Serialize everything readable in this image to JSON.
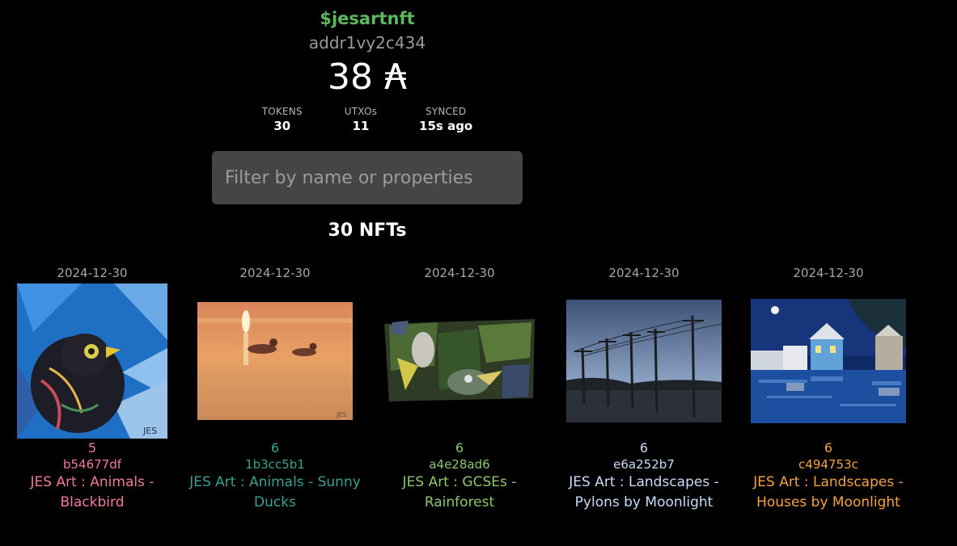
{
  "wallet": {
    "handle": "$jesartnft",
    "address": "addr1vy2c434",
    "balance_value": "38",
    "balance_symbol": "₳"
  },
  "stats": [
    {
      "label": "TOKENS",
      "value": "30"
    },
    {
      "label": "UTXOs",
      "value": "11"
    },
    {
      "label": "SYNCED",
      "value": "15s ago"
    }
  ],
  "filter": {
    "placeholder": "Filter by name or properties",
    "value": ""
  },
  "nft_count": "30 NFTs",
  "nfts": [
    {
      "date": "2024-12-30",
      "qty": "5",
      "id": "b54677df",
      "name": "JES Art : Animals - Blackbird",
      "color": "#ef7aa0",
      "image": "blackbird-painting"
    },
    {
      "date": "2024-12-30",
      "qty": "6",
      "id": "1b3cc5b1",
      "name": "JES Art : Animals - Sunny Ducks",
      "color": "#3aa195",
      "image": "ducks-painting"
    },
    {
      "date": "2024-12-30",
      "qty": "6",
      "id": "a4e28ad6",
      "name": "JES Art : GCSEs - Rainforest",
      "color": "#8fc56b",
      "image": "rainforest-collage"
    },
    {
      "date": "2024-12-30",
      "qty": "6",
      "id": "e6a252b7",
      "name": "JES Art : Landscapes - Pylons by Moonlight",
      "color": "#c7dcf5",
      "image": "pylons-painting"
    },
    {
      "date": "2024-12-30",
      "qty": "6",
      "id": "c494753c",
      "name": "JES Art : Landscapes - Houses by Moonlight",
      "color": "#f4a341",
      "image": "houses-painting"
    }
  ]
}
